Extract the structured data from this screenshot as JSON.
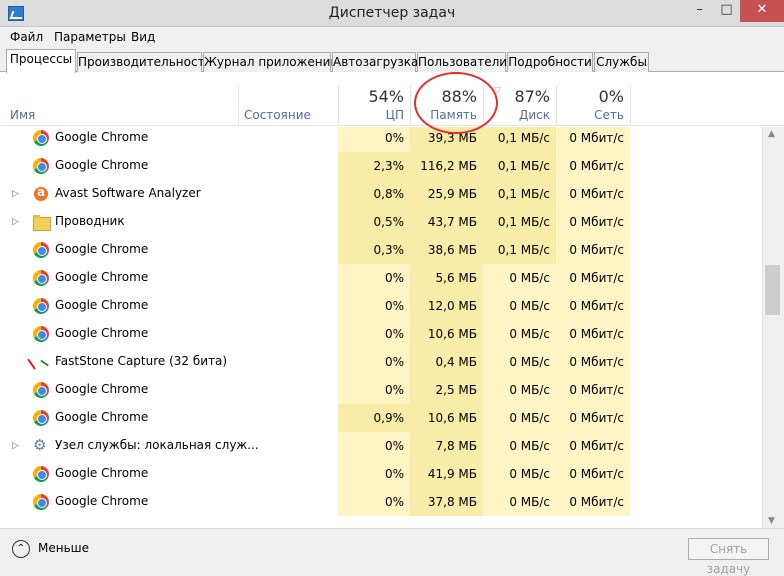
{
  "window": {
    "title": "Диспетчер задач",
    "buttons": {
      "minimize": "–",
      "maximize": "□",
      "close": "✕"
    }
  },
  "menu": [
    "Файл",
    "Параметры",
    "Вид"
  ],
  "tabs": [
    "Процессы",
    "Производительность",
    "Журнал приложений",
    "Автозагрузка",
    "Пользователи",
    "Подробности",
    "Службы"
  ],
  "active_tab": "Процессы",
  "columns": {
    "name": {
      "label": "Имя"
    },
    "status": {
      "label": "Состояние"
    },
    "cpu": {
      "percent": "54%",
      "label": "ЦП"
    },
    "memory": {
      "percent": "88%",
      "label": "Память"
    },
    "disk": {
      "percent": "87%",
      "label": "Диск"
    },
    "network": {
      "percent": "0%",
      "label": "Сеть"
    }
  },
  "processes": [
    {
      "name": "Google Chrome",
      "icon": "chrome-icon",
      "expandable": false,
      "cpu": "0%",
      "memory": "39,3 МБ",
      "disk": "0,1 МБ/с",
      "network": "0 Мбит/с"
    },
    {
      "name": "Google Chrome",
      "icon": "chrome-icon",
      "expandable": false,
      "cpu": "2,3%",
      "memory": "116,2 МБ",
      "disk": "0,1 МБ/с",
      "network": "0 Мбит/с"
    },
    {
      "name": "Avast Software Analyzer",
      "icon": "avast-icon",
      "expandable": true,
      "cpu": "0,8%",
      "memory": "25,9 МБ",
      "disk": "0,1 МБ/с",
      "network": "0 Мбит/с"
    },
    {
      "name": "Проводник",
      "icon": "folder-icon",
      "expandable": true,
      "cpu": "0,5%",
      "memory": "43,7 МБ",
      "disk": "0,1 МБ/с",
      "network": "0 Мбит/с"
    },
    {
      "name": "Google Chrome",
      "icon": "chrome-icon",
      "expandable": false,
      "cpu": "0,3%",
      "memory": "38,6 МБ",
      "disk": "0,1 МБ/с",
      "network": "0 Мбит/с"
    },
    {
      "name": "Google Chrome",
      "icon": "chrome-icon",
      "expandable": false,
      "cpu": "0%",
      "memory": "5,6 МБ",
      "disk": "0 МБ/с",
      "network": "0 Мбит/с"
    },
    {
      "name": "Google Chrome",
      "icon": "chrome-icon",
      "expandable": false,
      "cpu": "0%",
      "memory": "12,0 МБ",
      "disk": "0 МБ/с",
      "network": "0 Мбит/с"
    },
    {
      "name": "Google Chrome",
      "icon": "chrome-icon",
      "expandable": false,
      "cpu": "0%",
      "memory": "10,6 МБ",
      "disk": "0 МБ/с",
      "network": "0 Мбит/с"
    },
    {
      "name": "FastStone Capture (32 бита)",
      "icon": "faststone-icon",
      "expandable": false,
      "cpu": "0%",
      "memory": "0,4 МБ",
      "disk": "0 МБ/с",
      "network": "0 Мбит/с"
    },
    {
      "name": "Google Chrome",
      "icon": "chrome-icon",
      "expandable": false,
      "cpu": "0%",
      "memory": "2,5 МБ",
      "disk": "0 МБ/с",
      "network": "0 Мбит/с"
    },
    {
      "name": "Google Chrome",
      "icon": "chrome-icon",
      "expandable": false,
      "cpu": "0,9%",
      "memory": "10,6 МБ",
      "disk": "0 МБ/с",
      "network": "0 Мбит/с"
    },
    {
      "name": "Узел службы: локальная служ...",
      "icon": "gear-icon",
      "expandable": true,
      "cpu": "0%",
      "memory": "7,8 МБ",
      "disk": "0 МБ/с",
      "network": "0 Мбит/с"
    },
    {
      "name": "Google Chrome",
      "icon": "chrome-icon",
      "expandable": false,
      "cpu": "0%",
      "memory": "41,9 МБ",
      "disk": "0 МБ/с",
      "network": "0 Мбит/с"
    },
    {
      "name": "Google Chrome",
      "icon": "chrome-icon",
      "expandable": false,
      "cpu": "0%",
      "memory": "37,8 МБ",
      "disk": "0 МБ/с",
      "network": "0 Мбит/с"
    }
  ],
  "footer": {
    "fewer_details": "Меньше",
    "end_task": "Снять задачу"
  },
  "colors": {
    "heat_light": "#fff4c4",
    "heat_medium": "#f9eca8",
    "annotation_circle": "#e03030",
    "close_button": "#c75050"
  }
}
